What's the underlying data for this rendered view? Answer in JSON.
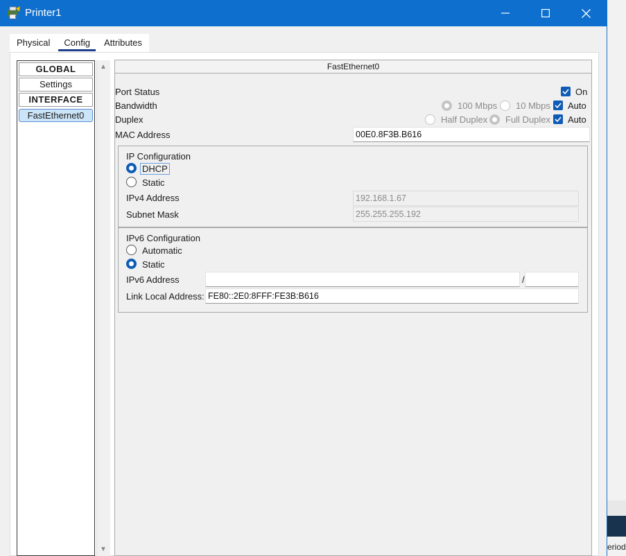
{
  "window": {
    "title": "Printer1"
  },
  "background_app": {
    "text": "eriod"
  },
  "tabs": [
    {
      "label": "Physical",
      "active": false
    },
    {
      "label": "Config",
      "active": true
    },
    {
      "label": "Attributes",
      "active": false
    }
  ],
  "sidebar": {
    "items": [
      {
        "label": "GLOBAL",
        "type": "header"
      },
      {
        "label": "Settings",
        "type": "item"
      },
      {
        "label": "INTERFACE",
        "type": "header"
      },
      {
        "label": "FastEthernet0",
        "type": "item",
        "selected": true
      }
    ]
  },
  "panel": {
    "title": "FastEthernet0",
    "port_status": {
      "label": "Port Status",
      "option_label": "On",
      "checked": true
    },
    "bandwidth": {
      "label": "Bandwidth",
      "opt_100": "100 Mbps",
      "opt_10": "10 Mbps",
      "auto_label": "Auto",
      "auto_checked": true
    },
    "duplex": {
      "label": "Duplex",
      "opt_half": "Half Duplex",
      "opt_full": "Full Duplex",
      "auto_label": "Auto",
      "auto_checked": true
    },
    "mac": {
      "label": "MAC Address",
      "value": "00E0.8F3B.B616"
    },
    "ip_config": {
      "title": "IP Configuration",
      "dhcp_label": "DHCP",
      "static_label": "Static",
      "selected": "DHCP",
      "ipv4_label": "IPv4 Address",
      "ipv4_value": "192.168.1.67",
      "subnet_label": "Subnet Mask",
      "subnet_value": "255.255.255.192"
    },
    "ipv6_config": {
      "title": "IPv6 Configuration",
      "automatic_label": "Automatic",
      "static_label": "Static",
      "selected": "Static",
      "address_label": "IPv6 Address",
      "address_value": "",
      "prefix_separator": "/",
      "prefix_value": "",
      "link_local_label": "Link Local Address:",
      "link_local_value": "FE80::2E0:8FFF:FE3B:B616"
    }
  },
  "colors": {
    "titlebar": "#0e6fcf",
    "accent": "#0f5bb5",
    "tab_underline": "#1c3e8a",
    "selected_item": "#cce4f7"
  }
}
